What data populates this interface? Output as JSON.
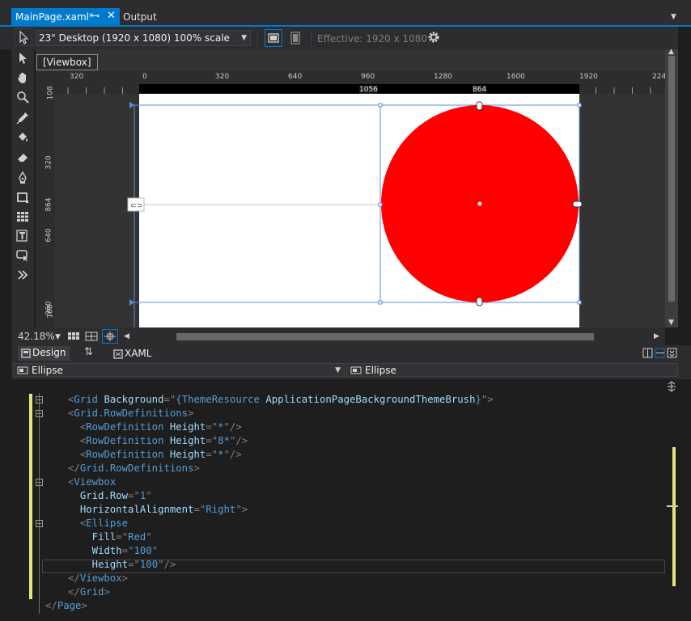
{
  "tabs": {
    "active": {
      "name": "MainPage.xaml*",
      "pin_glyph": "⊸",
      "close_glyph": "✕"
    },
    "other": {
      "name": "Output"
    }
  },
  "device_toolbar": {
    "device": "23\" Desktop (1920 x 1080) 100% scale",
    "effective": "Effective: 1920 x 1080"
  },
  "tooltip": "[Viewbox]",
  "hruler_labels": [
    "320",
    "0",
    "320",
    "640",
    "960",
    "1280",
    "1600",
    "1920",
    "224"
  ],
  "vruler_labels": [
    "108",
    "320",
    "864",
    "640",
    "960",
    "108"
  ],
  "canvas_labels": {
    "h1": "1056",
    "h2": "864"
  },
  "zoom": "42.18%",
  "split_tabs": {
    "design": "Design",
    "swap": "⇅",
    "xaml": "XAML"
  },
  "nav": {
    "left": "Ellipse",
    "right": "Ellipse"
  },
  "code": [
    {
      "indent": 2,
      "parts": [
        [
          "punc",
          "<"
        ],
        [
          "tag",
          "Grid"
        ],
        [
          "sp",
          " "
        ],
        [
          "attr",
          "Background"
        ],
        [
          "punc",
          "=\""
        ],
        [
          "tag",
          "{ThemeResource "
        ],
        [
          "attr",
          "ApplicationPageBackgroundThemeBrush"
        ],
        [
          "tag",
          "}"
        ],
        [
          "punc",
          "\">"
        ]
      ]
    },
    {
      "indent": 2,
      "parts": [
        [
          "punc",
          "<"
        ],
        [
          "tag",
          "Grid.RowDefinitions"
        ],
        [
          "punc",
          ">"
        ]
      ]
    },
    {
      "indent": 4,
      "parts": [
        [
          "punc",
          "<"
        ],
        [
          "tag",
          "RowDefinition"
        ],
        [
          "sp",
          " "
        ],
        [
          "attr",
          "Height"
        ],
        [
          "punc",
          "=\""
        ],
        [
          "tag",
          "*"
        ],
        [
          "punc",
          "\"/>"
        ]
      ]
    },
    {
      "indent": 4,
      "parts": [
        [
          "punc",
          "<"
        ],
        [
          "tag",
          "RowDefinition"
        ],
        [
          "sp",
          " "
        ],
        [
          "attr",
          "Height"
        ],
        [
          "punc",
          "=\""
        ],
        [
          "tag",
          "8*"
        ],
        [
          "punc",
          "\"/>"
        ]
      ]
    },
    {
      "indent": 4,
      "parts": [
        [
          "punc",
          "<"
        ],
        [
          "tag",
          "RowDefinition"
        ],
        [
          "sp",
          " "
        ],
        [
          "attr",
          "Height"
        ],
        [
          "punc",
          "=\""
        ],
        [
          "tag",
          "*"
        ],
        [
          "punc",
          "\"/>"
        ]
      ]
    },
    {
      "indent": 2,
      "parts": [
        [
          "punc",
          "</"
        ],
        [
          "tag",
          "Grid.RowDefinitions"
        ],
        [
          "punc",
          ">"
        ]
      ]
    },
    {
      "indent": 2,
      "parts": [
        [
          "punc",
          "<"
        ],
        [
          "tag",
          "Viewbox"
        ]
      ]
    },
    {
      "indent": 4,
      "parts": [
        [
          "attr",
          "Grid.Row"
        ],
        [
          "punc",
          "=\""
        ],
        [
          "tag",
          "1"
        ],
        [
          "punc",
          "\""
        ]
      ]
    },
    {
      "indent": 4,
      "parts": [
        [
          "attr",
          "HorizontalAlignment"
        ],
        [
          "punc",
          "=\""
        ],
        [
          "tag",
          "Right"
        ],
        [
          "punc",
          "\">"
        ]
      ]
    },
    {
      "indent": 4,
      "parts": [
        [
          "punc",
          "<"
        ],
        [
          "tag",
          "Ellipse"
        ]
      ]
    },
    {
      "indent": 6,
      "parts": [
        [
          "attr",
          "Fill"
        ],
        [
          "punc",
          "=\""
        ],
        [
          "tag",
          "Red"
        ],
        [
          "punc",
          "\""
        ]
      ]
    },
    {
      "indent": 6,
      "parts": [
        [
          "attr",
          "Width"
        ],
        [
          "punc",
          "=\""
        ],
        [
          "tag",
          "100"
        ],
        [
          "punc",
          "\""
        ]
      ]
    },
    {
      "indent": 6,
      "parts": [
        [
          "attr",
          "Height"
        ],
        [
          "punc",
          "=\""
        ],
        [
          "tag",
          "100"
        ],
        [
          "punc",
          "\"/>"
        ]
      ]
    },
    {
      "indent": 2,
      "parts": [
        [
          "punc",
          "</"
        ],
        [
          "tag",
          "Viewbox"
        ],
        [
          "punc",
          ">"
        ]
      ]
    },
    {
      "indent": 2,
      "parts": [
        [
          "punc",
          "</"
        ],
        [
          "tag",
          "Grid"
        ],
        [
          "punc",
          ">"
        ]
      ]
    },
    {
      "indent": 0,
      "parts": [
        [
          "punc",
          "</"
        ],
        [
          "tag",
          "Page"
        ],
        [
          "punc",
          ">"
        ]
      ]
    }
  ],
  "colors": {
    "accent": "#007acc",
    "ellipse": "#ff0000"
  }
}
